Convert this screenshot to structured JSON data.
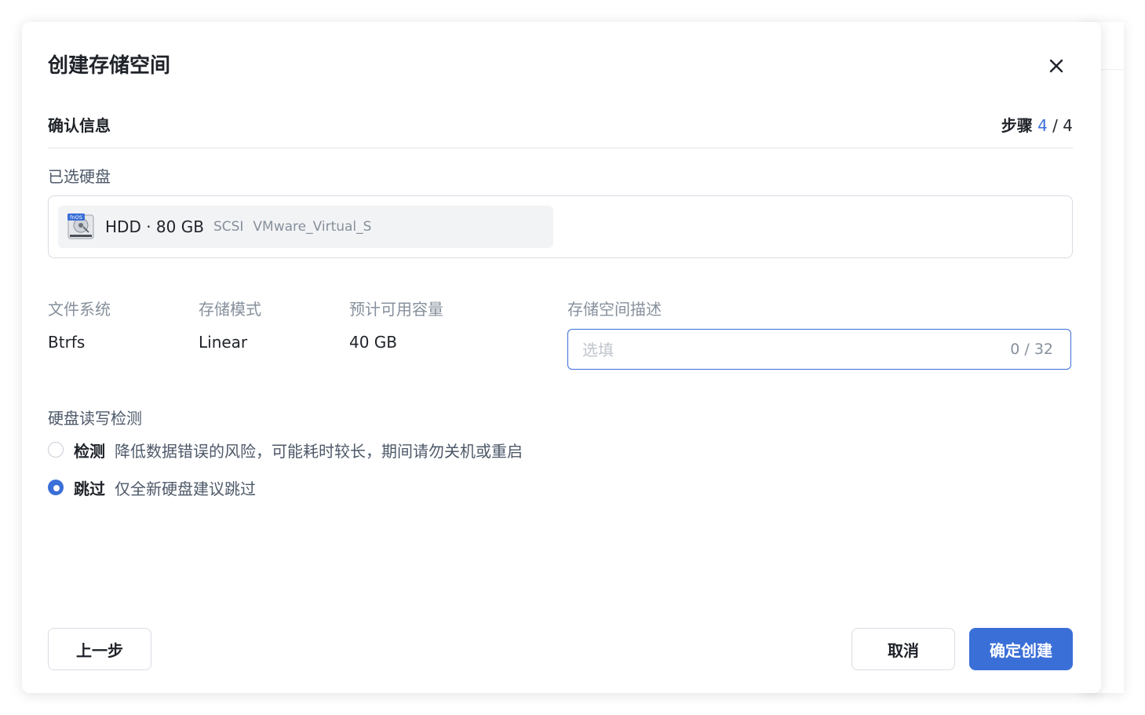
{
  "dialog": {
    "title": "创建存储空间",
    "close_icon": "close-icon"
  },
  "step": {
    "title": "确认信息",
    "label": "步骤",
    "current": "4",
    "separator": "/",
    "total": "4"
  },
  "selected_disks": {
    "label": "已选硬盘",
    "items": [
      {
        "icon": "hdd-icon",
        "badge": "fnOS",
        "name": "HDD · 80 GB",
        "interface": "SCSI",
        "model": "VMware_Virtual_S"
      }
    ]
  },
  "info": {
    "filesystem": {
      "label": "文件系统",
      "value": "Btrfs"
    },
    "mode": {
      "label": "存储模式",
      "value": "Linear"
    },
    "capacity": {
      "label": "预计可用容量",
      "value": "40 GB"
    }
  },
  "description": {
    "label": "存储空间描述",
    "placeholder": "选填",
    "value": "",
    "counter": "0 / 32"
  },
  "disk_check": {
    "label": "硬盘读写检测",
    "options": [
      {
        "title": "检测",
        "desc": "降低数据错误的风险，可能耗时较长，期间请勿关机或重启",
        "selected": false
      },
      {
        "title": "跳过",
        "desc": "仅全新硬盘建议跳过",
        "selected": true
      }
    ]
  },
  "footer": {
    "prev_label": "上一步",
    "cancel_label": "取消",
    "confirm_label": "确定创建"
  },
  "colors": {
    "accent": "#3b6fd8",
    "text": "#1f2329",
    "muted": "#86909c",
    "border": "#d9dce3"
  }
}
